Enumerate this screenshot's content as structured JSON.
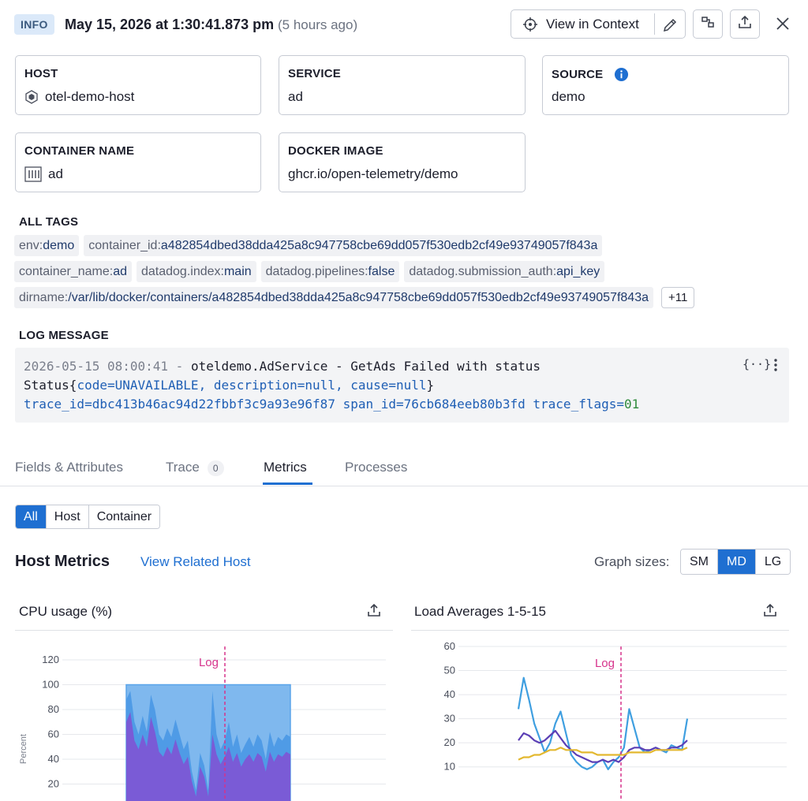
{
  "header": {
    "level": "INFO",
    "timestamp": "May 15, 2026 at 1:30:41.873 pm",
    "relative": "(5 hours ago)",
    "view_context": "View in Context"
  },
  "cards": {
    "host": {
      "label": "HOST",
      "value": "otel-demo-host"
    },
    "service": {
      "label": "SERVICE",
      "value": "ad"
    },
    "source": {
      "label": "SOURCE",
      "value": "demo"
    },
    "container_name": {
      "label": "CONTAINER NAME",
      "value": "ad"
    },
    "docker_image": {
      "label": "DOCKER IMAGE",
      "value": "ghcr.io/open-telemetry/demo"
    }
  },
  "tags": {
    "title": "ALL TAGS",
    "rows": [
      [
        {
          "k": "env:",
          "v": "demo"
        },
        {
          "k": "container_id:",
          "v": "a482854dbed38dda425a8c947758cbe69dd057f530edb2cf49e93749057f843a"
        }
      ],
      [
        {
          "k": "container_name:",
          "v": "ad"
        },
        {
          "k": "datadog.index:",
          "v": "main"
        },
        {
          "k": "datadog.pipelines:",
          "v": "false"
        },
        {
          "k": "datadog.submission_auth:",
          "v": "api_key"
        }
      ],
      [
        {
          "k": "dirname:",
          "v": "/var/lib/docker/containers/a482854dbed38dda425a8c947758cbe69dd057f530edb2cf49e93749057f843a"
        }
      ]
    ],
    "more": "+11"
  },
  "log": {
    "title": "LOG MESSAGE",
    "line1_ts": "2026-05-15 08:00:41",
    "line1_sep": " - ",
    "line1_rest": "oteldemo.AdService - GetAds Failed with status",
    "line2_a": "Status{",
    "line2_b": "code=UNAVAILABLE, description=null, cause=null",
    "line2_c": "}",
    "line3_a": "trace_id=dbc413b46ac94d22fbbf3c9a93e96f87 span_id=76cb684eeb80b3fd trace_flags=",
    "line3_b": "01",
    "format_icon_text": "{··}"
  },
  "tabs": {
    "fields": "Fields & Attributes",
    "trace": "Trace",
    "trace_count": "0",
    "metrics": "Metrics",
    "processes": "Processes"
  },
  "filter": {
    "all": "All",
    "host": "Host",
    "container": "Container"
  },
  "host_metrics": {
    "title": "Host Metrics",
    "related": "View Related Host",
    "graph_sizes_label": "Graph sizes:",
    "sizes": [
      "SM",
      "MD",
      "LG"
    ],
    "selected_size": "MD"
  },
  "colors": {
    "accent": "#1f6fd1",
    "log_marker": "#d6338c",
    "cpu_light": "#7fb8ee",
    "cpu_purple": "#7a5bd6"
  },
  "chart_data": [
    {
      "type": "area",
      "title": "CPU usage (%)",
      "ylabel": "Percent",
      "marker_label": "Log",
      "y_ticks": [
        "120",
        "100",
        "80",
        "60",
        "40",
        "20"
      ],
      "ylim": [
        0,
        120
      ],
      "series": [
        {
          "values": [
            100,
            100,
            100,
            100,
            100,
            100,
            100,
            100,
            100,
            100,
            100,
            100,
            100,
            100,
            100,
            100,
            100,
            100,
            100,
            100,
            100,
            100,
            100,
            100,
            100,
            100,
            100,
            100,
            100,
            100,
            100,
            100,
            100,
            100,
            100,
            100,
            100,
            100,
            100,
            100,
            100
          ]
        },
        {
          "values": [
            88,
            95,
            70,
            60,
            75,
            62,
            92,
            80,
            60,
            55,
            65,
            58,
            72,
            60,
            48,
            55,
            30,
            15,
            45,
            35,
            15,
            95,
            60,
            48,
            55,
            70,
            50,
            60,
            45,
            52,
            58,
            50,
            60,
            55,
            40,
            62,
            50,
            58,
            55,
            60,
            58
          ]
        },
        {
          "values": [
            70,
            78,
            55,
            48,
            60,
            50,
            74,
            62,
            46,
            42,
            50,
            44,
            56,
            45,
            36,
            42,
            22,
            10,
            34,
            26,
            10,
            60,
            44,
            36,
            42,
            50,
            38,
            45,
            34,
            40,
            44,
            38,
            45,
            42,
            30,
            46,
            38,
            44,
            42,
            46,
            44
          ]
        }
      ]
    },
    {
      "type": "line",
      "title": "Load Averages 1-5-15",
      "marker_label": "Log",
      "y_ticks": [
        "60",
        "50",
        "40",
        "30",
        "20",
        "10"
      ],
      "ylim": [
        5,
        60
      ],
      "series": [
        {
          "values": [
            34,
            47,
            38,
            28,
            22,
            16,
            20,
            28,
            33,
            24,
            15,
            12,
            10,
            9,
            10,
            12,
            13,
            9,
            12,
            14,
            18,
            34,
            26,
            18,
            16,
            17,
            18,
            17,
            16,
            19,
            18,
            17,
            30
          ]
        },
        {
          "values": [
            21,
            24,
            23,
            21,
            20,
            21,
            23,
            25,
            22,
            19,
            17,
            15,
            14,
            13,
            12,
            12,
            13,
            12,
            13,
            12,
            14,
            17,
            18,
            18,
            17,
            17,
            18,
            17,
            17,
            18,
            18,
            19,
            21
          ]
        },
        {
          "values": [
            13,
            14,
            14,
            15,
            15,
            16,
            17,
            17,
            18,
            17,
            17,
            17,
            16,
            16,
            16,
            15,
            15,
            15,
            15,
            15,
            15,
            16,
            16,
            16,
            16,
            16,
            17,
            17,
            17,
            17,
            17,
            17,
            18
          ]
        }
      ]
    }
  ]
}
